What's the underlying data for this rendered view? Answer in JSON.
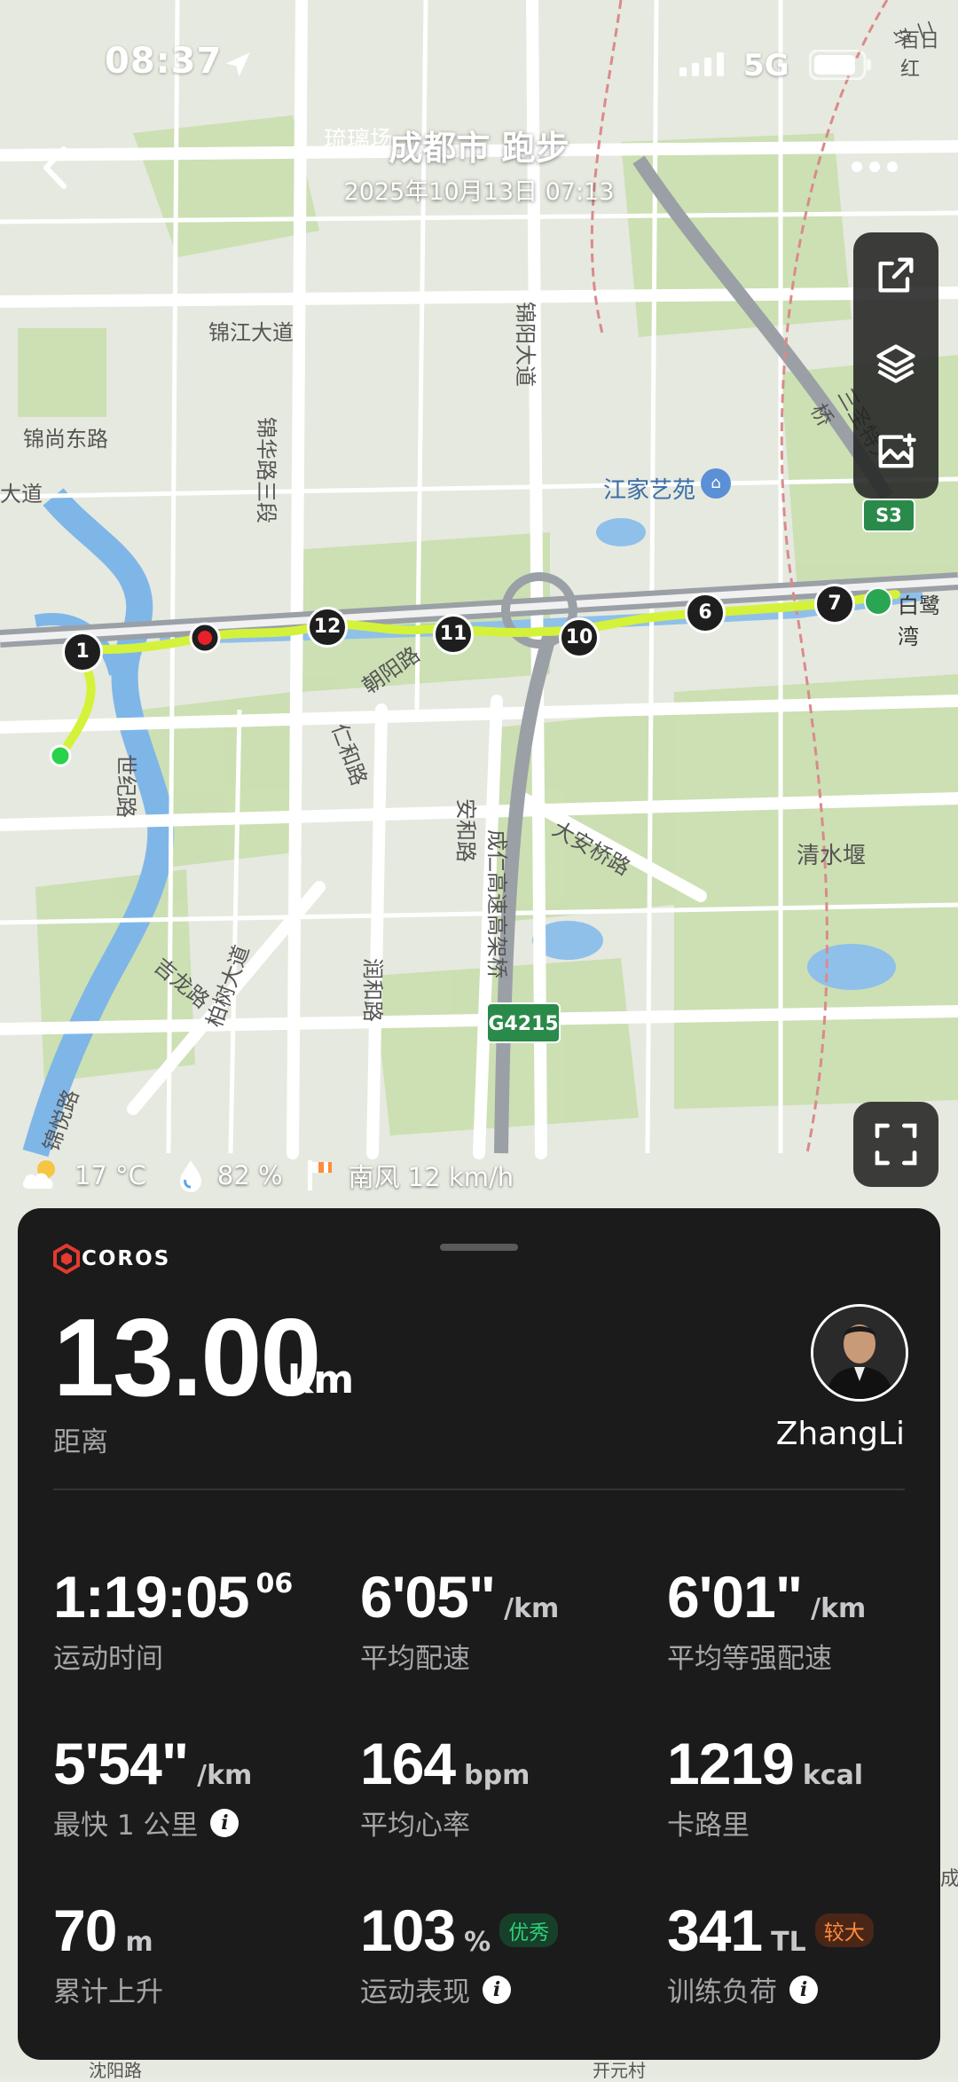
{
  "status_bar": {
    "time": "08:37",
    "network": "5G"
  },
  "header": {
    "title": "成都市 跑步",
    "datetime": "2025年10月13日 07:13"
  },
  "map": {
    "labels": [
      "琉璃场",
      "锦江大道",
      "锦尚东路",
      "锦华路三段",
      "锦阳大道",
      "三圣特大桥",
      "江家艺苑",
      "朝阳路",
      "仁和路",
      "安和路",
      "成仁高速高架桥",
      "大安桥路",
      "清水堰",
      "吉龙路",
      "润和路",
      "柏树大道",
      "锦悦路",
      "白鹭湾",
      "世纪路",
      "大道",
      "沈阳路",
      "开元村",
      "成",
      "二环",
      "百日红"
    ],
    "shields": [
      "S3",
      "G4215"
    ],
    "km_markers": [
      "1",
      "12",
      "11",
      "10",
      "6",
      "7"
    ],
    "route_color": "#d4f23a"
  },
  "weather": {
    "temperature": "17 °C",
    "humidity": "82 %",
    "wind": "南风 12 km/h"
  },
  "summary": {
    "brand": "COROS",
    "distance_value": "13.00",
    "distance_unit": "km",
    "distance_label": "距离",
    "user_name": "ZhangLi"
  },
  "stats": [
    {
      "value": "1:19:05",
      "sup": "06",
      "unit": "",
      "label": "运动时间"
    },
    {
      "value": "6'05\"",
      "unit": "/km",
      "label": "平均配速"
    },
    {
      "value": "6'01\"",
      "unit": "/km",
      "label": "平均等强配速"
    },
    {
      "value": "5'54\"",
      "unit": "/km",
      "label": "最快 1 公里",
      "info": "i"
    },
    {
      "value": "164",
      "unit": "bpm",
      "label": "平均心率"
    },
    {
      "value": "1219",
      "unit": "kcal",
      "label": "卡路里"
    },
    {
      "value": "70",
      "unit": "m",
      "label": "累计上升"
    },
    {
      "value": "103",
      "unit": "%",
      "label": "运动表现",
      "badge": "优秀",
      "info": "i"
    },
    {
      "value": "341",
      "unit": "TL",
      "label": "训练负荷",
      "badge": "较大",
      "info": "i"
    }
  ]
}
